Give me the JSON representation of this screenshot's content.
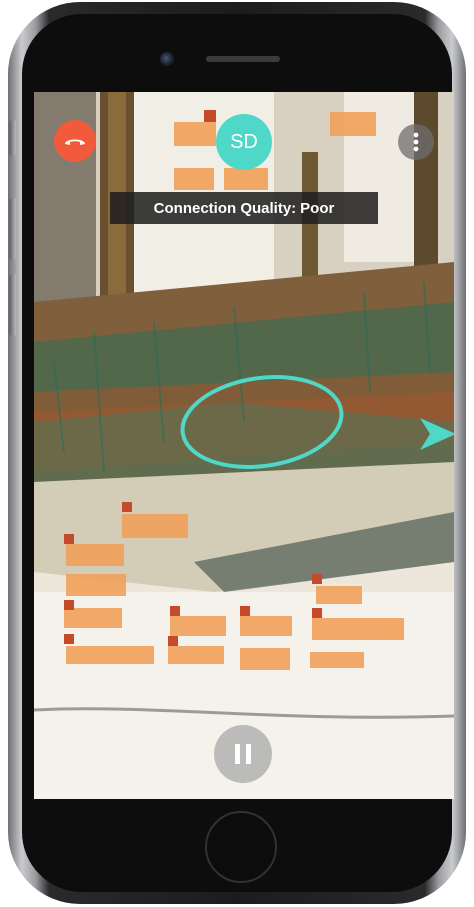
{
  "call": {
    "avatar_initials": "SD",
    "connection_label": "Connection Quality:",
    "connection_value": "Poor"
  },
  "icons": {
    "end_call": "phone-hangup-icon",
    "more": "more-vertical-icon",
    "pause": "pause-icon",
    "arrow": "annotation-arrow-icon"
  },
  "colors": {
    "end_call": "#f15a3a",
    "avatar": "#4fd8c8",
    "annotation": "#4fd8c8",
    "pause": "#afafaf"
  }
}
